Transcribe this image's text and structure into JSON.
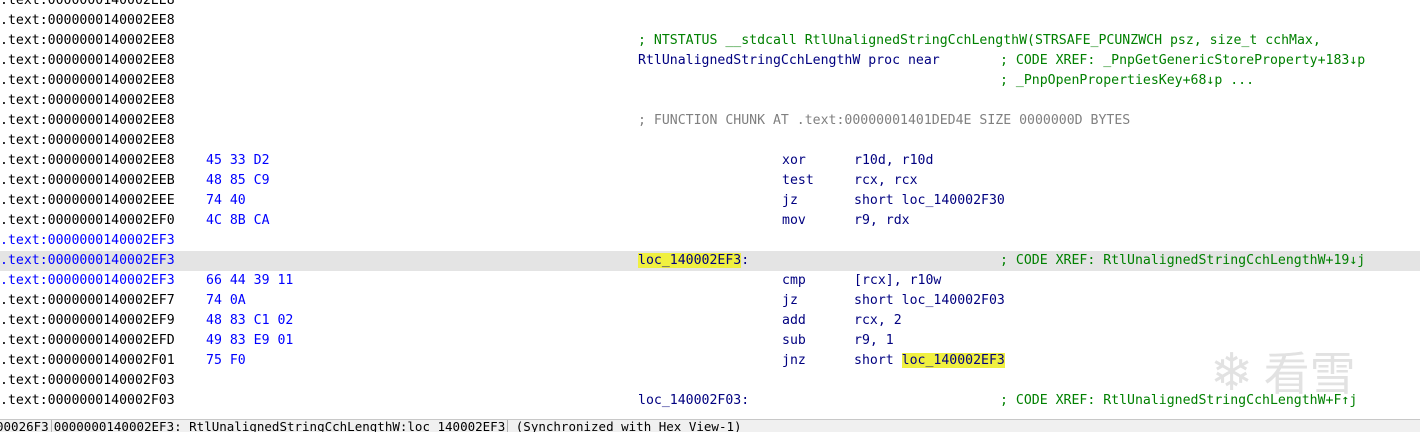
{
  "disassembly": {
    "lines": [
      {
        "addr": ".text:0000000140002EE8",
        "addr_blue": false,
        "current": false,
        "bytes": "",
        "label": "",
        "mnem": "",
        "ops": "",
        "comment": "",
        "comment_gray": false,
        "xref": ""
      },
      {
        "addr": ".text:0000000140002EE8",
        "addr_blue": false,
        "current": false,
        "bytes": "",
        "label": "",
        "mnem": "",
        "ops": "",
        "comment": "",
        "comment_gray": false,
        "xref": ""
      },
      {
        "addr": ".text:0000000140002EE8",
        "addr_blue": false,
        "current": false,
        "bytes": "",
        "label": "",
        "mnem": "",
        "ops": "",
        "comment": "; NTSTATUS __stdcall RtlUnalignedStringCchLengthW(STRSAFE_PCUNZWCH psz, size_t cchMax,",
        "comment_gray": false,
        "xref": ""
      },
      {
        "addr": ".text:0000000140002EE8",
        "addr_blue": false,
        "current": false,
        "bytes": "",
        "label": "RtlUnalignedStringCchLengthW proc near",
        "mnem": "",
        "ops": "",
        "comment": "",
        "comment_gray": false,
        "xref": "; CODE XREF: _PnpGetGenericStoreProperty+183↓p"
      },
      {
        "addr": ".text:0000000140002EE8",
        "addr_blue": false,
        "current": false,
        "bytes": "",
        "label": "",
        "mnem": "",
        "ops": "",
        "comment": "",
        "comment_gray": false,
        "xref": "; _PnpOpenPropertiesKey+68↓p ..."
      },
      {
        "addr": ".text:0000000140002EE8",
        "addr_blue": false,
        "current": false,
        "bytes": "",
        "label": "",
        "mnem": "",
        "ops": "",
        "comment": "",
        "comment_gray": false,
        "xref": ""
      },
      {
        "addr": ".text:0000000140002EE8",
        "addr_blue": false,
        "current": false,
        "bytes": "",
        "label": "",
        "mnem": "",
        "ops": "",
        "comment": "; FUNCTION CHUNK AT .text:00000001401DED4E SIZE 0000000D BYTES",
        "comment_gray": true,
        "xref": ""
      },
      {
        "addr": ".text:0000000140002EE8",
        "addr_blue": false,
        "current": false,
        "bytes": "",
        "label": "",
        "mnem": "",
        "ops": "",
        "comment": "",
        "comment_gray": false,
        "xref": ""
      },
      {
        "addr": ".text:0000000140002EE8",
        "addr_blue": false,
        "current": false,
        "bytes": "45 33 D2",
        "label": "",
        "mnem": "xor",
        "ops": "r10d, r10d",
        "comment": "",
        "comment_gray": false,
        "xref": ""
      },
      {
        "addr": ".text:0000000140002EEB",
        "addr_blue": false,
        "current": false,
        "bytes": "48 85 C9",
        "label": "",
        "mnem": "test",
        "ops": "rcx, rcx",
        "comment": "",
        "comment_gray": false,
        "xref": ""
      },
      {
        "addr": ".text:0000000140002EEE",
        "addr_blue": false,
        "current": false,
        "bytes": "74 40",
        "label": "",
        "mnem": "jz",
        "ops": "short loc_140002F30",
        "comment": "",
        "comment_gray": false,
        "xref": ""
      },
      {
        "addr": ".text:0000000140002EF0",
        "addr_blue": false,
        "current": false,
        "bytes": "4C 8B CA",
        "label": "",
        "mnem": "mov",
        "ops": "r9, rdx",
        "comment": "",
        "comment_gray": false,
        "xref": ""
      },
      {
        "addr": ".text:0000000140002EF3",
        "addr_blue": true,
        "current": false,
        "bytes": "",
        "label": "",
        "mnem": "",
        "ops": "",
        "comment": "",
        "comment_gray": false,
        "xref": ""
      },
      {
        "addr": ".text:0000000140002EF3",
        "addr_blue": true,
        "current": true,
        "bytes": "",
        "label": "loc_140002EF3:",
        "mnem": "",
        "ops": "",
        "comment": "",
        "comment_gray": false,
        "xref": "; CODE XREF: RtlUnalignedStringCchLengthW+19↓j"
      },
      {
        "addr": ".text:0000000140002EF3",
        "addr_blue": true,
        "current": false,
        "bytes": "66 44 39 11",
        "label": "",
        "mnem": "cmp",
        "ops": "[rcx], r10w",
        "comment": "",
        "comment_gray": false,
        "xref": ""
      },
      {
        "addr": ".text:0000000140002EF7",
        "addr_blue": false,
        "current": false,
        "bytes": "74 0A",
        "label": "",
        "mnem": "jz",
        "ops": "short loc_140002F03",
        "comment": "",
        "comment_gray": false,
        "xref": ""
      },
      {
        "addr": ".text:0000000140002EF9",
        "addr_blue": false,
        "current": false,
        "bytes": "48 83 C1 02",
        "label": "",
        "mnem": "add",
        "ops": "rcx, 2",
        "comment": "",
        "comment_gray": false,
        "xref": ""
      },
      {
        "addr": ".text:0000000140002EFD",
        "addr_blue": false,
        "current": false,
        "bytes": "49 83 E9 01",
        "label": "",
        "mnem": "sub",
        "ops": "r9, 1",
        "comment": "",
        "comment_gray": false,
        "xref": ""
      },
      {
        "addr": ".text:0000000140002F01",
        "addr_blue": false,
        "current": false,
        "bytes": "75 F0",
        "label": "",
        "mnem": "jnz",
        "ops": "short loc_140002EF3",
        "comment": "",
        "comment_gray": false,
        "xref": ""
      },
      {
        "addr": ".text:0000000140002F03",
        "addr_blue": false,
        "current": false,
        "bytes": "",
        "label": "",
        "mnem": "",
        "ops": "",
        "comment": "",
        "comment_gray": false,
        "xref": ""
      },
      {
        "addr": ".text:0000000140002F03",
        "addr_blue": false,
        "current": false,
        "bytes": "",
        "label": "loc_140002F03:",
        "mnem": "",
        "ops": "",
        "comment": "",
        "comment_gray": false,
        "xref": "; CODE XREF: RtlUnalignedStringCchLengthW+F↑j"
      }
    ],
    "highlight_word": "loc_140002EF3"
  },
  "watermark": {
    "icon": "snowflake-icon",
    "text": "看雪"
  },
  "status_bar": {
    "offset": "00026F3",
    "location": "0000000140002EF3: RtlUnalignedStringCchLengthW:loc_140002EF3",
    "sync": "(Synchronized with Hex View-1)"
  },
  "colors": {
    "address": "#000000",
    "address_current": "#0000ff",
    "bytes": "#0000ff",
    "code": "#000080",
    "comment": "#008000",
    "chunk_comment": "#808080",
    "highlight": "#f0f040",
    "current_line": "#e4e4e4"
  }
}
